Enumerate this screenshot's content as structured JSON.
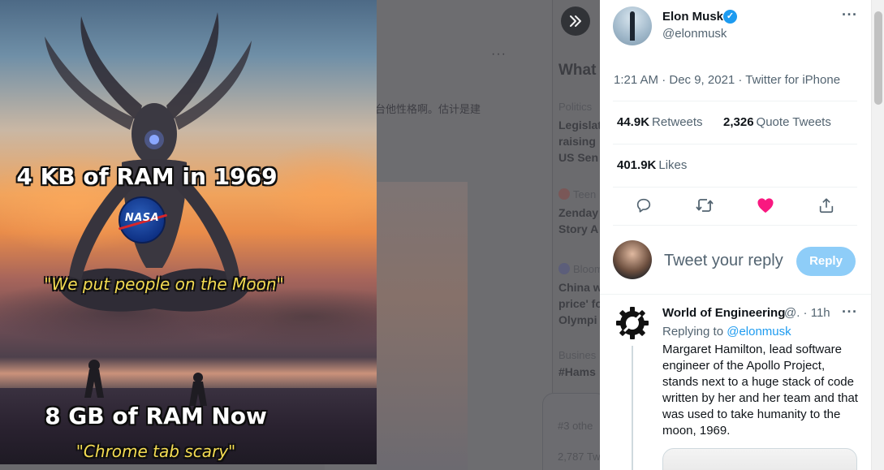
{
  "background_feed": {
    "more_glyph": "···",
    "cjk_snippet": "台他性格啊。估计是建",
    "trends_title": "What",
    "trends": [
      {
        "meta": "Politics",
        "lines": [
          "Legislat",
          "raising",
          "US Sen"
        ]
      },
      {
        "meta": "Teen",
        "lines": [
          "Zenday",
          "Story A"
        ]
      },
      {
        "meta": "Bloom",
        "lines": [
          "China w",
          "price' fo",
          "Olympi"
        ]
      },
      {
        "meta": "Busines",
        "lines": [
          "#Hams"
        ]
      }
    ],
    "messages_snippet": [
      "#3 othe",
      "2,787 Tw"
    ]
  },
  "media": {
    "top_caption": "4 KB of RAM in 1969",
    "nasa_logo_text": "NASA",
    "quote_top": "\"We put people on the Moon\"",
    "bottom_caption": "8 GB of RAM Now",
    "quote_bottom": "\"Chrome tab scary\""
  },
  "tweet": {
    "author_name": "Elon Musk",
    "author_handle": "@elonmusk",
    "timestamp": "1:21 AM · Dec 9, 2021 · Twitter for iPhone",
    "retweets_count": "44.9K",
    "retweets_label": "Retweets",
    "quotes_count": "2,326",
    "quotes_label": "Quote Tweets",
    "likes_count": "401.9K",
    "likes_label": "Likes",
    "liked": true
  },
  "reply_box": {
    "placeholder": "Tweet your reply",
    "button_label": "Reply"
  },
  "reply": {
    "author_name": "World of Engineering",
    "meta": "@. · 11h",
    "replying_prefix": "Replying to",
    "replying_to": "@elonmusk",
    "text": "Margaret Hamilton, lead software engineer of the Apollo Project, stands next to a huge stack of code written by her and her team and that was used to take humanity to the moon, 1969."
  },
  "colors": {
    "accent": "#1d9bf0",
    "like": "#f91880",
    "reply_button_disabled": "#8ecdf8",
    "secondary_text": "#536471"
  },
  "icons": [
    "double-chevron-right-icon",
    "verified-badge-icon",
    "more-horizontal-icon",
    "reply-icon",
    "retweet-icon",
    "heart-icon",
    "share-icon"
  ]
}
